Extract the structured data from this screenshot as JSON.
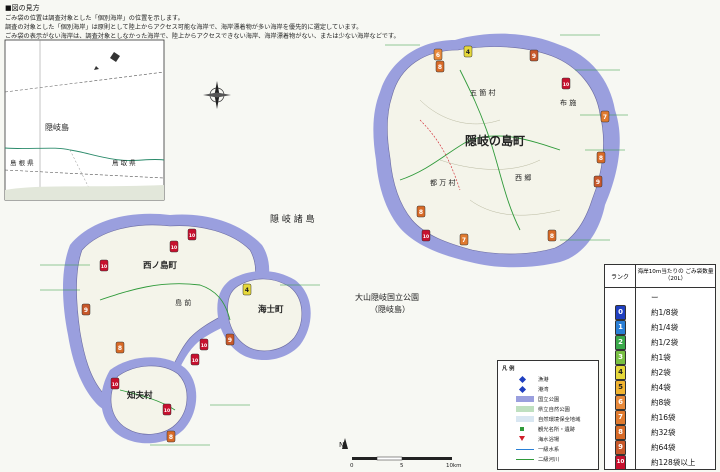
{
  "guide": {
    "title": "■図の見方",
    "lines": [
      "ごみ袋の位置は調査対象とした「個別海岸」の位置を示します。",
      "調査の対象とした「個別海岸」は原則として陸上からアクセス可能な海岸で、海岸漂着物が多い海岸を優先的に選定しています。",
      "ごみ袋の表示がない海岸は、調査対象としなかった海岸で、陸上からアクセスできない海岸、海岸漂着物がない、または少ない海岸などです。"
    ]
  },
  "inset": {
    "island": "隠岐島",
    "pref_left": "島 根 県",
    "pref_right": "鳥 取 県"
  },
  "places": {
    "dogo_town": "隠岐の島町",
    "nishinoshima": "西ノ島町",
    "ama": "海士町",
    "chibu": "知夫村",
    "park_line1": "大山隠岐国立公園",
    "park_line2": "（隠岐島）",
    "islands_label": "隠 岐 諸 島",
    "goka": "五 箇 村",
    "tsuma": "都 万 村",
    "fuse": "布 施",
    "saigo": "西 郷",
    "kazura": "島 前",
    "oki": "隠 岐"
  },
  "legend": {
    "title": "凡 例",
    "items": [
      "漁港",
      "港湾",
      "国立公園",
      "県立自然公園",
      "自然環境保全地域",
      "観光名所・遺跡",
      "海水浴場",
      "一級水系",
      "二級河川"
    ],
    "extra": [
      "◆漁港",
      "◆港湾",
      "■自然環境保全地域",
      "▼ 海水浴場"
    ]
  },
  "scale": {
    "north": "N",
    "labels": [
      "0",
      "5",
      "10km"
    ]
  },
  "ranks": {
    "header_rank": "ランク",
    "header_amount": "海岸10m当たりの ごみ袋数量（20L）",
    "rows": [
      {
        "rank": "",
        "amount": "ー",
        "color": "#ffffff",
        "glyph": ""
      },
      {
        "rank": "0",
        "amount": "約1/8袋",
        "color": "#1f3fc0",
        "glyph": "0"
      },
      {
        "rank": "1",
        "amount": "約1/4袋",
        "color": "#2a7fd6",
        "glyph": "1"
      },
      {
        "rank": "2",
        "amount": "約1/2袋",
        "color": "#3aa94a",
        "glyph": "2"
      },
      {
        "rank": "3",
        "amount": "約1袋",
        "color": "#78c043",
        "glyph": "3"
      },
      {
        "rank": "4",
        "amount": "約2袋",
        "color": "#e6d83a",
        "glyph": "4"
      },
      {
        "rank": "5",
        "amount": "約4袋",
        "color": "#f2b531",
        "glyph": "5"
      },
      {
        "rank": "6",
        "amount": "約8袋",
        "color": "#e8893a",
        "glyph": "6"
      },
      {
        "rank": "7",
        "amount": "約16袋",
        "color": "#e07a2f",
        "glyph": "7"
      },
      {
        "rank": "8",
        "amount": "約32袋",
        "color": "#d86a27",
        "glyph": "8"
      },
      {
        "rank": "9",
        "amount": "約64袋",
        "color": "#c8582a",
        "glyph": "9"
      },
      {
        "rank": "10",
        "amount": "約128袋以上",
        "color": "#c8102e",
        "glyph": "10"
      }
    ]
  },
  "markers": [
    {
      "id": "d1",
      "rank": "6"
    },
    {
      "id": "d2",
      "rank": "4"
    },
    {
      "id": "d3",
      "rank": "8"
    },
    {
      "id": "d4",
      "rank": "9"
    },
    {
      "id": "d5",
      "rank": "10"
    },
    {
      "id": "d6",
      "rank": "7"
    },
    {
      "id": "d7",
      "rank": "8"
    },
    {
      "id": "d8",
      "rank": "9"
    },
    {
      "id": "d9",
      "rank": "8"
    },
    {
      "id": "d10",
      "rank": "7"
    },
    {
      "id": "d11",
      "rank": "10"
    },
    {
      "id": "d12",
      "rank": "8"
    },
    {
      "id": "n1",
      "rank": "10"
    },
    {
      "id": "n2",
      "rank": "10"
    },
    {
      "id": "n3",
      "rank": "9"
    },
    {
      "id": "n4",
      "rank": "10"
    },
    {
      "id": "n5",
      "rank": "8"
    },
    {
      "id": "n6",
      "rank": "4"
    },
    {
      "id": "n7",
      "rank": "10"
    },
    {
      "id": "n8",
      "rank": "10"
    },
    {
      "id": "n9",
      "rank": "9"
    },
    {
      "id": "n10",
      "rank": "10"
    },
    {
      "id": "n11",
      "rank": "8"
    },
    {
      "id": "n12",
      "rank": "10"
    }
  ],
  "colors": {
    "coast_buffer": "#9a9fde",
    "land": "#f4f4ea",
    "sea": "#f7f8f3",
    "route_green": "#2f9a3a",
    "beach_red": "#d0202a"
  }
}
